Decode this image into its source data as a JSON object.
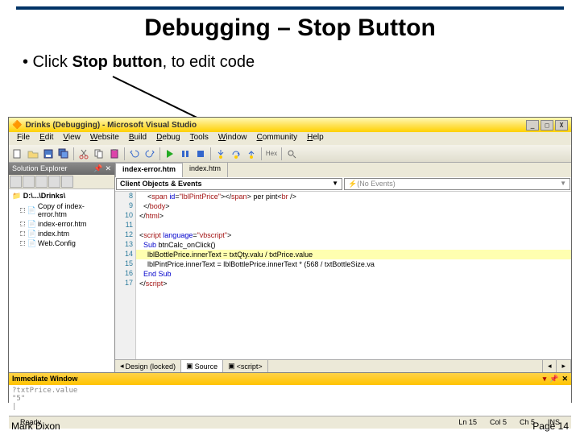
{
  "slide": {
    "title": "Debugging – Stop Button",
    "bullet_prefix": "• Click ",
    "bullet_bold": "Stop button",
    "bullet_suffix": ", to edit code",
    "author": "Mark Dixon",
    "page": "Page 14"
  },
  "vs": {
    "title": "Drinks (Debugging) - Microsoft Visual Studio",
    "menu": [
      "File",
      "Edit",
      "View",
      "Website",
      "Build",
      "Debug",
      "Tools",
      "Window",
      "Community",
      "Help"
    ],
    "solExplorer": {
      "title": "Solution Explorer",
      "root": "D:\\...\\Drinks\\",
      "items": [
        "Copy of index-error.htm",
        "index-error.htm",
        "index.htm",
        "Web.Config"
      ]
    },
    "fileTabs": [
      "index-error.htm",
      "index.htm"
    ],
    "editorDropdowns": {
      "left": "Client Objects & Events",
      "right": "(No Events)"
    },
    "code": {
      "startLine": 8,
      "lines": [
        {
          "n": 8,
          "html": "    &lt;<span class='c-maroon'>span</span> <span class='c-blue'>id</span>=<span class='c-maroon'>\"lblPintPrice\"</span>&gt;&lt;/<span class='c-maroon'>span</span>&gt; per pint&lt;<span class='c-maroon'>br</span> /&gt;"
        },
        {
          "n": 9,
          "html": "  &lt;/<span class='c-maroon'>body</span>&gt;"
        },
        {
          "n": 10,
          "html": "&lt;/<span class='c-maroon'>html</span>&gt;"
        },
        {
          "n": 11,
          "html": ""
        },
        {
          "n": 12,
          "html": "&lt;<span class='c-maroon'>script</span> <span class='c-blue'>language</span>=<span class='c-maroon'>\"vbscript\"</span>&gt;",
          "cls": "c-gray"
        },
        {
          "n": 13,
          "html": "  <span class='c-blue'>Sub</span> btnCalc_onClick()",
          "bp": true
        },
        {
          "n": 14,
          "html": "    lblBottlePrice.innerText = txtQty.valu / txtPrice.value",
          "hl": true
        },
        {
          "n": 15,
          "html": "    lblPintPrice.innerText = lblBottlePrice.innerText * (568 / txtBottleSize.va"
        },
        {
          "n": 16,
          "html": "  <span class='c-blue'>End Sub</span>"
        },
        {
          "n": 17,
          "html": "&lt;/<span class='c-maroon'>script</span>&gt;"
        }
      ]
    },
    "viewTabs": [
      "Design (locked)",
      "Source",
      "<script>"
    ],
    "immediate": {
      "title": "Immediate Window",
      "lines": [
        "?txtPrice.value",
        "\"5\""
      ]
    },
    "status": {
      "ready": "Ready",
      "ln": "Ln 15",
      "col": "Col 5",
      "ch": "Ch 5",
      "ins": "INS"
    }
  }
}
